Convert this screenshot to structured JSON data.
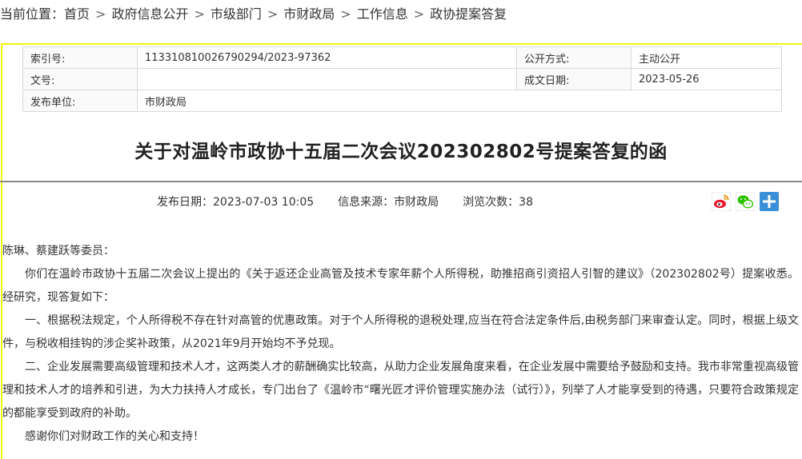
{
  "breadcrumb": {
    "prefix": "当前位置：",
    "items": [
      "首页",
      "政府信息公开",
      "市级部门",
      "市财政局",
      "工作信息",
      "政协提案答复"
    ]
  },
  "meta": {
    "index_label": "索引号:",
    "index_value": "113310810026790294/2023-97362",
    "open_mode_label": "公开方式:",
    "open_mode_value": "主动公开",
    "doc_no_label": "文号:",
    "doc_no_value": "",
    "date_label": "成文日期:",
    "date_value": "2023-05-26",
    "publisher_label": "发布单位:",
    "publisher_value": "市财政局"
  },
  "article": {
    "title": "关于对温岭市政协十五届二次会议202302802号提案答复的函",
    "publish_label": "发布日期：",
    "publish_value": "2023-07-03 10:05",
    "source_label": "信息来源：",
    "source_value": "市财政局",
    "views_label": "浏览次数：",
    "views_value": "38",
    "paragraphs": [
      "陈琳、蔡建跃等委员：",
      "你们在温岭市政协十五届二次会议上提出的《关于返还企业高管及技术专家年薪个人所得税，助推招商引资招人引智的建议》（202302802号）提案收悉。经研究，现答复如下：",
      "一、根据税法规定，个人所得税不存在针对高管的优惠政策。对于个人所得税的退税处理,应当在符合法定条件后,由税务部门来审查认定。同时，根据上级文件，与税收相挂钩的涉企奖补政策，从2021年9月开始均不予兑现。",
      "二、企业发展需要高级管理和技术人才，这两类人才的薪酬确实比较高，从助力企业发展角度来看，在企业发展中需要给予鼓励和支持。我市非常重视高级管理和技术人才的培养和引进，为大力扶持人才成长，专门出台了《温岭市“曙光匠才评价管理实施办法（试行）》，列举了人才能享受到的待遇，只要符合政策规定的都能享受到政府的补助。",
      "感谢你们对财政工作的关心和支持！"
    ]
  },
  "share": {
    "icons": [
      "weibo-icon",
      "wechat-icon",
      "more-share-icon"
    ],
    "colors": {
      "weibo": "#e6162d",
      "wechat": "#2dc100",
      "more": "#3a8fd8"
    }
  }
}
